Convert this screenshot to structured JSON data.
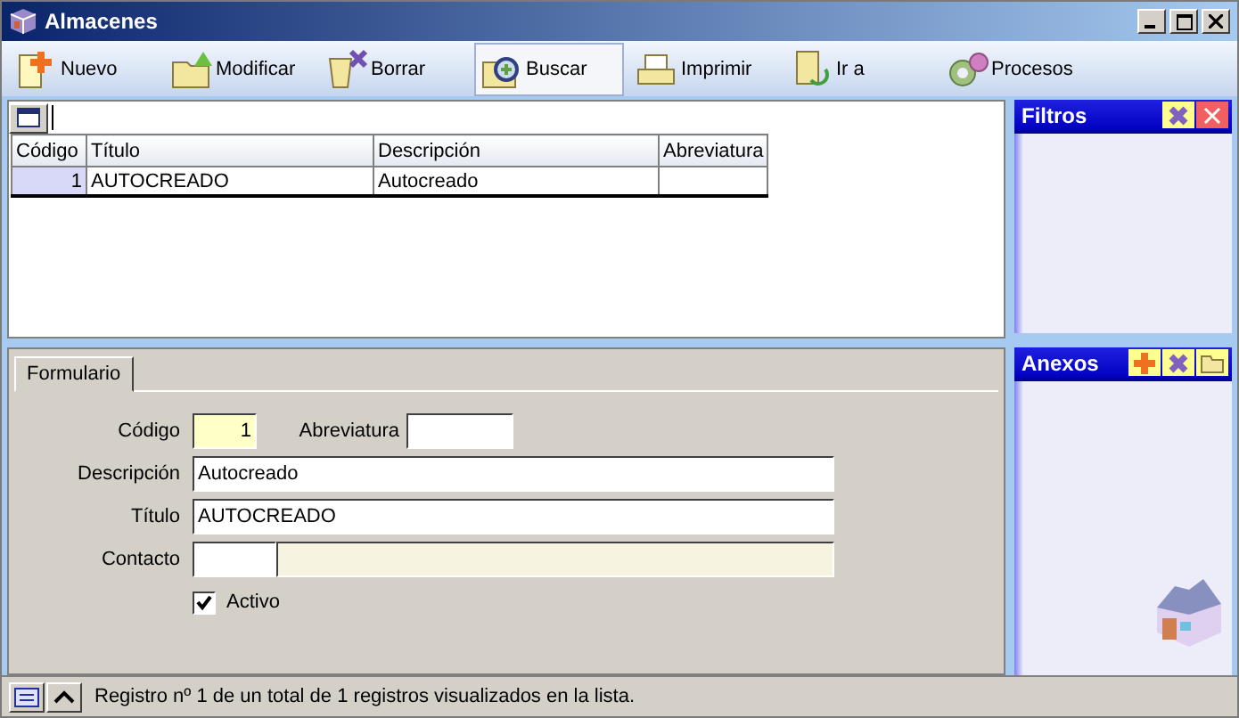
{
  "window": {
    "title": "Almacenes"
  },
  "toolbar": [
    {
      "label": "Nuevo",
      "kind": "new",
      "selected": false
    },
    {
      "label": "Modificar",
      "kind": "edit",
      "selected": false
    },
    {
      "label": "Borrar",
      "kind": "delete",
      "selected": false
    },
    {
      "label": "Buscar",
      "kind": "search",
      "selected": true
    },
    {
      "label": "Imprimir",
      "kind": "print",
      "selected": false
    },
    {
      "label": "Ir a",
      "kind": "goto",
      "selected": false
    },
    {
      "label": "Procesos",
      "kind": "process",
      "selected": false
    }
  ],
  "table": {
    "columns": [
      "Código",
      "Título",
      "Descripción",
      "Abreviatura"
    ],
    "rows": [
      {
        "cells": [
          "1",
          "AUTOCREADO",
          "Autocreado"
        ],
        "selected": true
      }
    ]
  },
  "form": {
    "tabs": [
      {
        "label": "Formulario",
        "selected": true
      }
    ],
    "codigo": {
      "label": "Código",
      "value": "1"
    },
    "abreviatura": {
      "label": "Abreviatura"
    },
    "descripcion": {
      "label": "Descripción",
      "value": "Autocreado"
    },
    "titulo": {
      "label": "Título",
      "value": "AUTOCREADO"
    },
    "contacto": {
      "label": "Contacto"
    },
    "activo": {
      "label": "Activo",
      "checked": true
    }
  },
  "filters_panel": {
    "title": "Filtros"
  },
  "annexes_panel": {
    "title": "Anexos"
  },
  "status_bar": {
    "text": "Registro nº 1 de un total de 1 registros visualizados en la lista."
  }
}
